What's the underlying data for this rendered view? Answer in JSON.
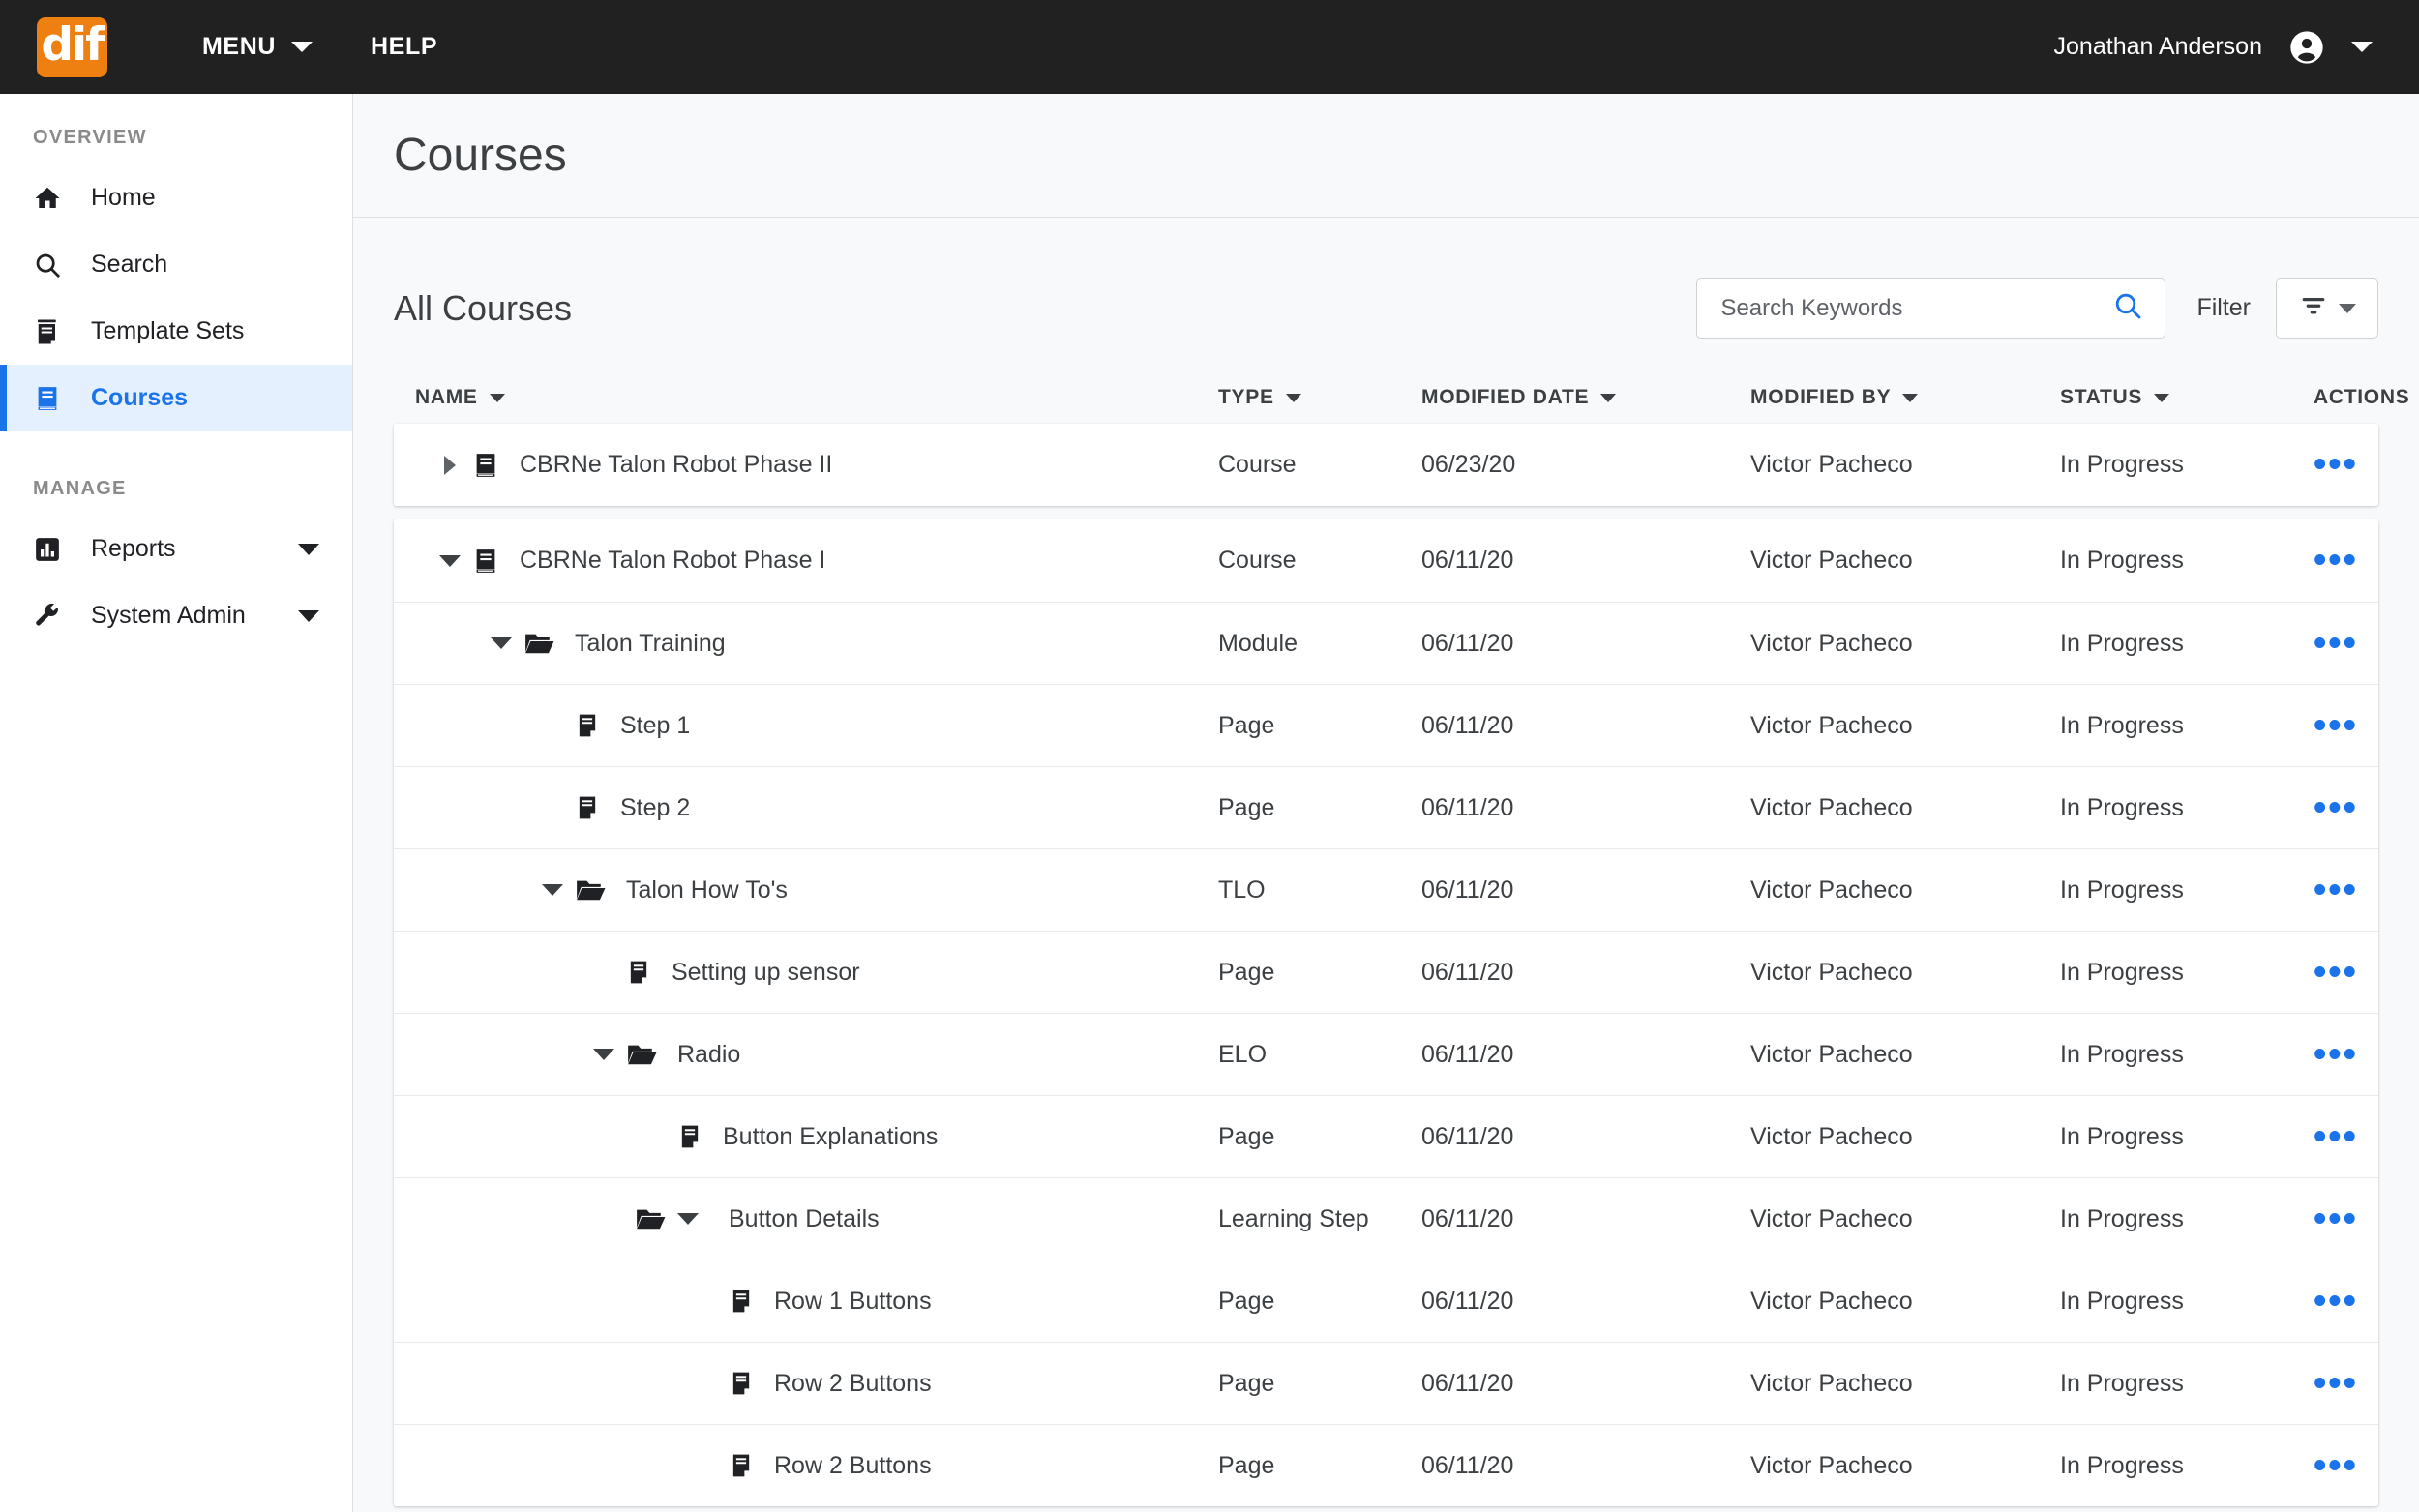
{
  "topbar": {
    "logo_text": "dif",
    "menu_label": "MENU",
    "help_label": "HELP",
    "user_name": "Jonathan Anderson",
    "logo_color": "#EE7F11",
    "bar_color": "#212121"
  },
  "sidebar": {
    "group_overview": "OVERVIEW",
    "group_manage": "MANAGE",
    "accent_color": "#1a73e8",
    "active_bg": "#e4f0fd",
    "items": [
      {
        "label": "Home",
        "icon": "home-icon",
        "active": false,
        "expandable": false
      },
      {
        "label": "Search",
        "icon": "search-icon",
        "active": false,
        "expandable": false
      },
      {
        "label": "Template Sets",
        "icon": "template-sets-icon",
        "active": false,
        "expandable": false
      },
      {
        "label": "Courses",
        "icon": "book-icon",
        "active": true,
        "expandable": false
      }
    ],
    "manage_items": [
      {
        "label": "Reports",
        "icon": "bar-chart-icon",
        "active": false,
        "expandable": true
      },
      {
        "label": "System Admin",
        "icon": "wrench-icon",
        "active": false,
        "expandable": true
      }
    ]
  },
  "page": {
    "title": "Courses",
    "section_title": "All Courses"
  },
  "search": {
    "placeholder": "Search Keywords",
    "value": "",
    "icon": "search-icon"
  },
  "filter": {
    "label": "Filter",
    "icon": "filter-lines-icon"
  },
  "table": {
    "columns": [
      {
        "label": "NAME",
        "sortable": true
      },
      {
        "label": "TYPE",
        "sortable": true
      },
      {
        "label": "MODIFIED DATE",
        "sortable": true
      },
      {
        "label": "MODIFIED BY",
        "sortable": true
      },
      {
        "label": "STATUS",
        "sortable": true
      },
      {
        "label": "ACTIONS",
        "sortable": false
      }
    ],
    "actions_glyph": "•••",
    "groups": [
      {
        "rows": [
          {
            "name": "CBRNe Talon Robot Phase II",
            "type": "Course",
            "modified_date": "06/23/20",
            "modified_by": "Victor Pacheco",
            "status": "In Progress",
            "indent": 0,
            "twisty": "collapsed",
            "twisty_after_icon": false,
            "icon": "book-icon"
          }
        ]
      },
      {
        "rows": [
          {
            "name": "CBRNe Talon Robot Phase I",
            "type": "Course",
            "modified_date": "06/11/20",
            "modified_by": "Victor Pacheco",
            "status": "In Progress",
            "indent": 0,
            "twisty": "expanded",
            "twisty_after_icon": false,
            "icon": "book-icon"
          },
          {
            "name": "Talon Training",
            "type": "Module",
            "modified_date": "06/11/20",
            "modified_by": "Victor Pacheco",
            "status": "In Progress",
            "indent": 1,
            "twisty": "expanded",
            "twisty_after_icon": false,
            "icon": "folder-open-icon"
          },
          {
            "name": "Step 1",
            "type": "Page",
            "modified_date": "06/11/20",
            "modified_by": "Victor Pacheco",
            "status": "In Progress",
            "indent": 2,
            "twisty": "none",
            "twisty_after_icon": false,
            "icon": "page-icon"
          },
          {
            "name": "Step 2",
            "type": "Page",
            "modified_date": "06/11/20",
            "modified_by": "Victor Pacheco",
            "status": "In Progress",
            "indent": 2,
            "twisty": "none",
            "twisty_after_icon": false,
            "icon": "page-icon"
          },
          {
            "name": "Talon How To's",
            "type": "TLO",
            "modified_date": "06/11/20",
            "modified_by": "Victor Pacheco",
            "status": "In Progress",
            "indent": 2,
            "twisty": "expanded",
            "twisty_after_icon": false,
            "icon": "folder-open-icon"
          },
          {
            "name": "Setting up sensor",
            "type": "Page",
            "modified_date": "06/11/20",
            "modified_by": "Victor Pacheco",
            "status": "In Progress",
            "indent": 3,
            "twisty": "none",
            "twisty_after_icon": false,
            "icon": "page-icon"
          },
          {
            "name": "Radio",
            "type": "ELO",
            "modified_date": "06/11/20",
            "modified_by": "Victor Pacheco",
            "status": "In Progress",
            "indent": 3,
            "twisty": "expanded",
            "twisty_after_icon": false,
            "icon": "folder-open-icon"
          },
          {
            "name": "Button Explanations",
            "type": "Page",
            "modified_date": "06/11/20",
            "modified_by": "Victor Pacheco",
            "status": "In Progress",
            "indent": 4,
            "twisty": "none",
            "twisty_after_icon": false,
            "icon": "page-icon"
          },
          {
            "name": "Button Details",
            "type": "Learning Step",
            "modified_date": "06/11/20",
            "modified_by": "Victor Pacheco",
            "status": "In Progress",
            "indent": 4,
            "twisty": "expanded",
            "twisty_after_icon": true,
            "icon": "folder-open-icon"
          },
          {
            "name": "Row 1 Buttons",
            "type": "Page",
            "modified_date": "06/11/20",
            "modified_by": "Victor Pacheco",
            "status": "In Progress",
            "indent": 5,
            "twisty": "none",
            "twisty_after_icon": false,
            "icon": "page-icon"
          },
          {
            "name": "Row 2 Buttons",
            "type": "Page",
            "modified_date": "06/11/20",
            "modified_by": "Victor Pacheco",
            "status": "In Progress",
            "indent": 5,
            "twisty": "none",
            "twisty_after_icon": false,
            "icon": "page-icon"
          },
          {
            "name": "Row 2 Buttons",
            "type": "Page",
            "modified_date": "06/11/20",
            "modified_by": "Victor Pacheco",
            "status": "In Progress",
            "indent": 5,
            "twisty": "none",
            "twisty_after_icon": false,
            "icon": "page-icon"
          }
        ]
      }
    ]
  }
}
